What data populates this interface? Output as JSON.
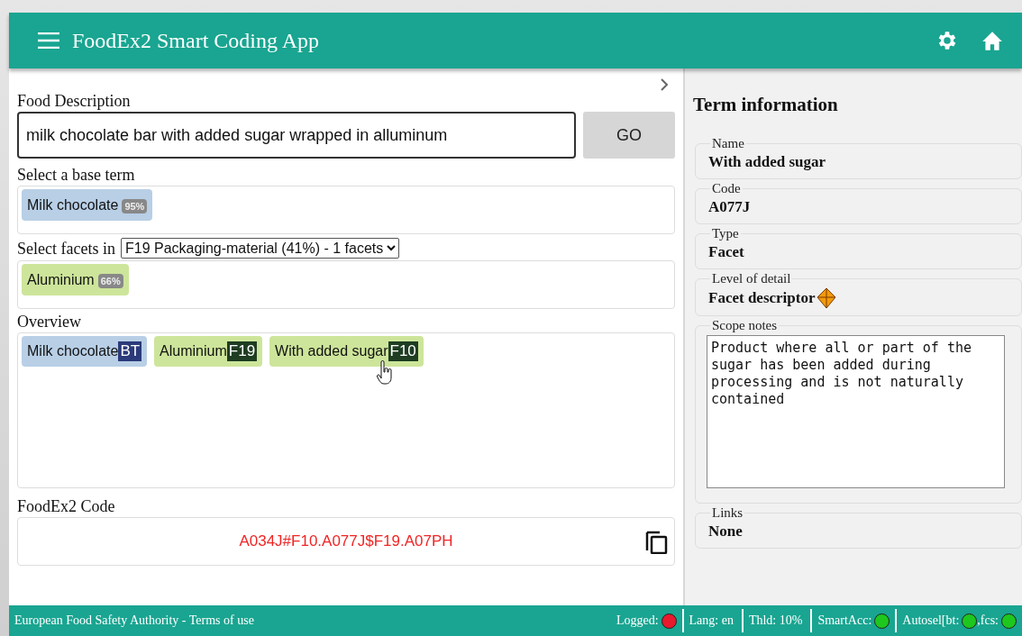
{
  "header": {
    "title": "FoodEx2 Smart Coding App"
  },
  "food_description": {
    "label": "Food Description",
    "value": "milk chocolate bar with added sugar wrapped in alluminum",
    "button": "GO"
  },
  "base_term": {
    "label": "Select a base term",
    "chips": [
      {
        "name": "Milk chocolate",
        "score": "95%"
      }
    ]
  },
  "facets": {
    "label": "Select facets in",
    "dropdown": "F19 Packaging-material (41%) - 1 facets",
    "chips": [
      {
        "name": "Aluminium",
        "score": "66%"
      }
    ]
  },
  "overview": {
    "label": "Overview",
    "chips": [
      {
        "kind": "base",
        "name": "Milk chocolate",
        "code": "BT"
      },
      {
        "kind": "facet",
        "name": "Aluminium",
        "code": "F19"
      },
      {
        "kind": "facet",
        "name": "With added sugar",
        "code": "F10"
      }
    ]
  },
  "code": {
    "label": "FoodEx2 Code",
    "value": "A034J#F10.A077J$F19.A07PH"
  },
  "term_information": {
    "title": "Term information",
    "fields": [
      {
        "kind": "text",
        "label": "Name",
        "value": "With added sugar"
      },
      {
        "kind": "text",
        "label": "Code",
        "value": "A077J"
      },
      {
        "kind": "text",
        "label": "Type",
        "value": "Facet"
      },
      {
        "kind": "detail",
        "label": "Level of detail",
        "value": "Facet descriptor"
      },
      {
        "kind": "notes",
        "label": "Scope notes",
        "value": "Product where all or part of the sugar has been added during processing and is not naturally contained"
      },
      {
        "kind": "text",
        "label": "Links",
        "value": "None"
      }
    ]
  },
  "footer": {
    "text": "European Food Safety Authority - Terms of use",
    "status": [
      {
        "parts": [
          {
            "text": "Logged:",
            "color": "#e8192c"
          }
        ]
      },
      {
        "parts": [
          {
            "text": "Lang: en"
          }
        ]
      },
      {
        "parts": [
          {
            "text": "Thld: 10%"
          }
        ]
      },
      {
        "parts": [
          {
            "text": "SmartAcc:",
            "color": "#1ec71e"
          }
        ]
      },
      {
        "parts": [
          {
            "text": "Autosel[bt:",
            "color": "#1ec71e"
          },
          {
            "text": ",fcs:",
            "color": "#1ec71e"
          }
        ]
      }
    ]
  }
}
